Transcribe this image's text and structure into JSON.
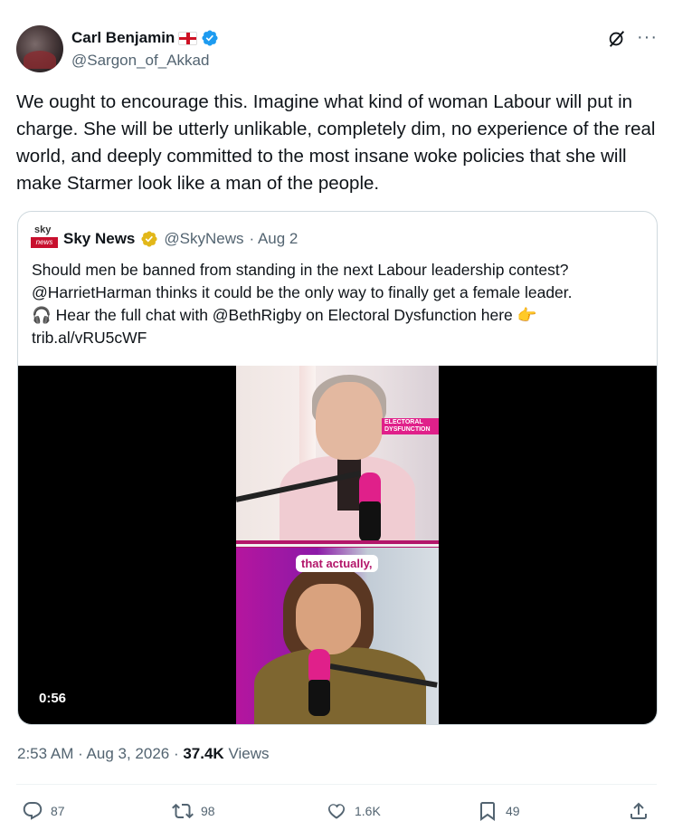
{
  "author": {
    "name": "Carl Benjamin",
    "handle": "@Sargon_of_Akkad"
  },
  "tweet": {
    "text": "We ought to encourage this. Imagine what kind of woman Labour will put in charge. She will be utterly unlikable, completely dim, no experience of the real world, and deeply committed to the most insane woke policies that she will make Starmer look like a man of the people."
  },
  "quote": {
    "logo_top": "sky",
    "logo_bottom": "news",
    "name": "Sky News",
    "handle": "@SkyNews",
    "date": "· Aug 2",
    "line1": "Should men be banned from standing in the next Labour leadership contest?",
    "line2": "@HarrietHarman thinks it could be the only way to finally get a female leader.",
    "line3": "🎧 Hear the full chat with @BethRigby on Electoral Dysfunction here 👉",
    "line4": "trib.al/vRU5cWF",
    "video": {
      "tag": "ELECTORAL DYSFUNCTION",
      "caption": "that actually,",
      "duration": "0:56"
    }
  },
  "meta": {
    "time_date": "2:53 AM · Aug 3, 2026 · ",
    "views_count": "37.4K",
    "views_label": " Views"
  },
  "actions": {
    "replies": "87",
    "reposts": "98",
    "likes": "1.6K",
    "bookmarks": "49"
  },
  "colors": {
    "accent_blue": "#1d9bf0",
    "gold_badge": "#e2b719",
    "text_primary": "#0f1419",
    "text_secondary": "#536471"
  }
}
